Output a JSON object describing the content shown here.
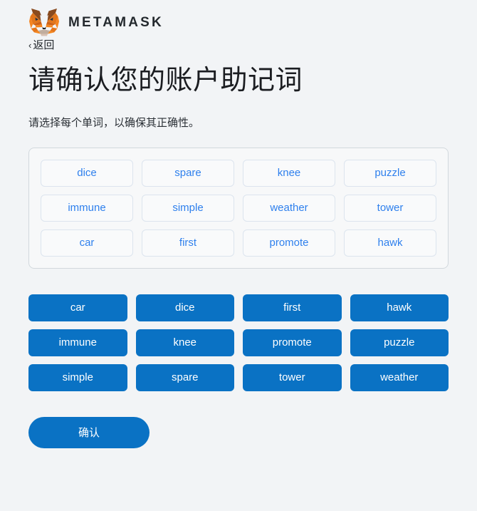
{
  "brand": {
    "name": "METAMASK",
    "logo_icon": "metamask-fox-icon",
    "fox_colors": {
      "orange": "#e2761b",
      "orange_light": "#f5841f",
      "brown_dark": "#763d16",
      "brown": "#8a4b1e",
      "cream": "#c0ad9e",
      "white": "#ffffff"
    }
  },
  "nav": {
    "back_label": "返回",
    "back_chevron": "‹"
  },
  "header": {
    "title": "请确认您的账户助记词",
    "subtitle": "请选择每个单词，以确保其正确性。"
  },
  "colors": {
    "page_background": "#f2f4f6",
    "accent_blue": "#0a72c4",
    "slot_text_blue": "#2f80ed",
    "panel_border": "#d2d8dd",
    "slot_border": "#dce4ee",
    "text_dark": "#24292e"
  },
  "seed_slots": {
    "columns": 4,
    "words": [
      "dice",
      "spare",
      "knee",
      "puzzle",
      "immune",
      "simple",
      "weather",
      "tower",
      "car",
      "first",
      "promote",
      "hawk"
    ]
  },
  "word_bank": {
    "columns": 4,
    "words": [
      "car",
      "dice",
      "first",
      "hawk",
      "immune",
      "knee",
      "promote",
      "puzzle",
      "simple",
      "spare",
      "tower",
      "weather"
    ]
  },
  "footer": {
    "confirm_label": "确认"
  }
}
